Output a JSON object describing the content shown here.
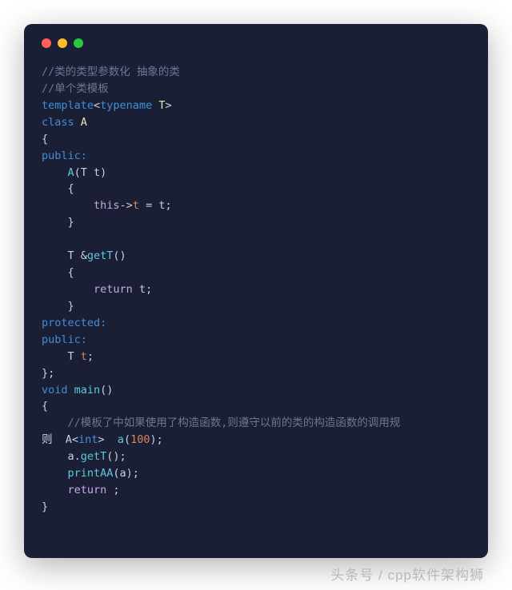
{
  "code": {
    "l1": "//类的类型参数化 抽象的类",
    "l2": "//单个类模板",
    "l3a": "template",
    "l3b": "<",
    "l3c": "typename",
    "l3d": " T",
    "l3e": ">",
    "l4a": "class",
    "l4b": " A",
    "l5": "{",
    "l6": "public:",
    "l7a": "    ",
    "l7b": "A",
    "l7c": "(T t)",
    "l8": "    {",
    "l9a": "        ",
    "l9b": "this",
    "l9c": "->",
    "l9d": "t",
    "l9e": " = t;",
    "l10": "    }",
    "l11": "",
    "l12a": "    T &",
    "l12b": "getT",
    "l12c": "()",
    "l13": "    {",
    "l14a": "        ",
    "l14b": "return",
    "l14c": " t;",
    "l15": "    }",
    "l16": "protected:",
    "l17": "public:",
    "l18a": "    T ",
    "l18b": "t",
    "l18c": ";",
    "l19": "};",
    "l20a": "void",
    "l20b": " ",
    "l20c": "main",
    "l20d": "()",
    "l21": "{",
    "l22": "    //模板了中如果使用了构造函数,则遵守以前的类的构造函数的调用规",
    "l23a": "则  A<",
    "l23b": "int",
    "l23c": ">  ",
    "l23d": "a",
    "l23e": "(",
    "l23f": "100",
    "l23g": ");",
    "l24a": "    a.",
    "l24b": "getT",
    "l24c": "();",
    "l25a": "    ",
    "l25b": "printAA",
    "l25c": "(a);",
    "l26a": "    ",
    "l26b": "return",
    "l26c": " ;",
    "l27": "}"
  },
  "watermark": "头条号 / cpp软件架构狮"
}
